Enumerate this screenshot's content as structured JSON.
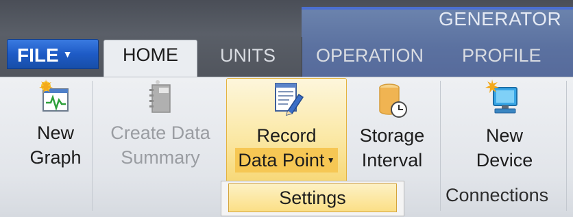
{
  "title_bar": {
    "context_group_label": "GENERATOR"
  },
  "tabs": {
    "file": "FILE",
    "home": "HOME",
    "units": "UNITS",
    "operation": "OPERATION",
    "profile": "PROFILE"
  },
  "ribbon": {
    "new_graph": {
      "line1": "New",
      "line2": "Graph",
      "icon": "new-graph-icon"
    },
    "create_summary": {
      "line1": "Create Data",
      "line2": "Summary",
      "icon": "notebook-icon",
      "enabled": false
    },
    "record_data_point": {
      "line1": "Record",
      "line2": "Data Point",
      "icon": "notepad-pencil-icon",
      "highlighted": true
    },
    "storage_interval": {
      "line1": "Storage",
      "line2": "Interval",
      "icon": "storage-clock-icon"
    },
    "new_device": {
      "line1": "New",
      "line2": "Device",
      "icon": "computer-icon"
    },
    "group_connections": "Connections"
  },
  "dropdown": {
    "settings": "Settings"
  },
  "colors": {
    "file_tab": "#1e5bc6",
    "context_group": "#5b71a0",
    "highlight": "#f6c754"
  }
}
